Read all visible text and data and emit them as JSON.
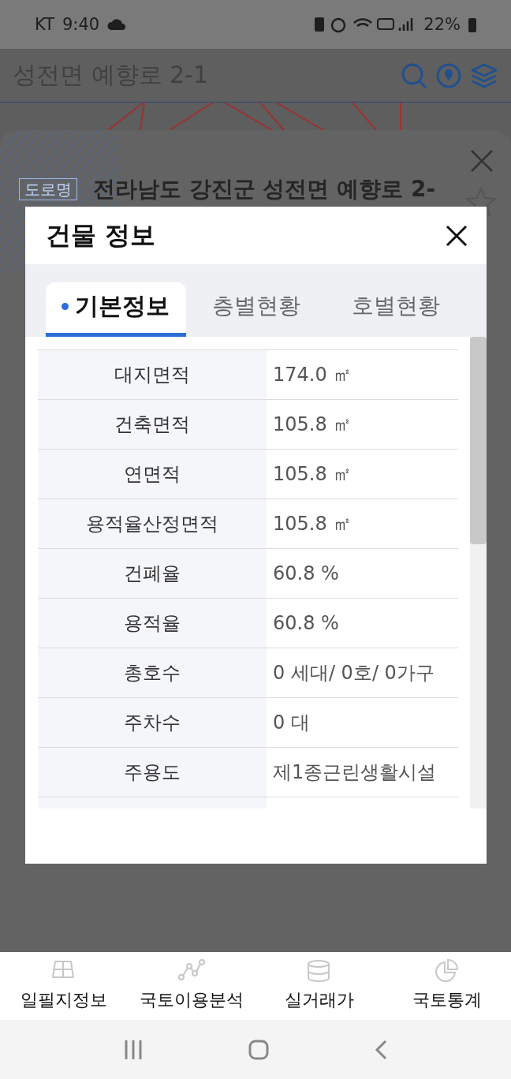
{
  "status_bar": {
    "carrier": "KT",
    "time": "9:40",
    "battery": "22%"
  },
  "header": {
    "title": "성전면 예향로 2-1"
  },
  "place_sheet": {
    "badge": "도로명",
    "address": "전라남도 강진군 성전면 예향로 2-"
  },
  "dialog": {
    "title": "건물 정보",
    "tabs": [
      {
        "label": "기본정보",
        "selected": true
      },
      {
        "label": "층별현황",
        "selected": false
      },
      {
        "label": "호별현황",
        "selected": false
      }
    ],
    "rows": [
      {
        "label": "대지면적",
        "value": "174.0 ㎡"
      },
      {
        "label": "건축면적",
        "value": "105.8 ㎡"
      },
      {
        "label": "연면적",
        "value": "105.8 ㎡"
      },
      {
        "label": "용적율산정면적",
        "value": "105.8 ㎡"
      },
      {
        "label": "건폐율",
        "value": "60.8 %"
      },
      {
        "label": "용적율",
        "value": "60.8 %"
      },
      {
        "label": "총호수",
        "value": "0 세대/ 0호/ 0가구"
      },
      {
        "label": "주차수",
        "value": "0 대"
      },
      {
        "label": "주용도",
        "value": "제1종근린생활시설"
      }
    ]
  },
  "bottom_nav": {
    "items": [
      {
        "label": "일필지정보"
      },
      {
        "label": "국토이용분석"
      },
      {
        "label": "실거래가"
      },
      {
        "label": "국토통계"
      }
    ]
  }
}
